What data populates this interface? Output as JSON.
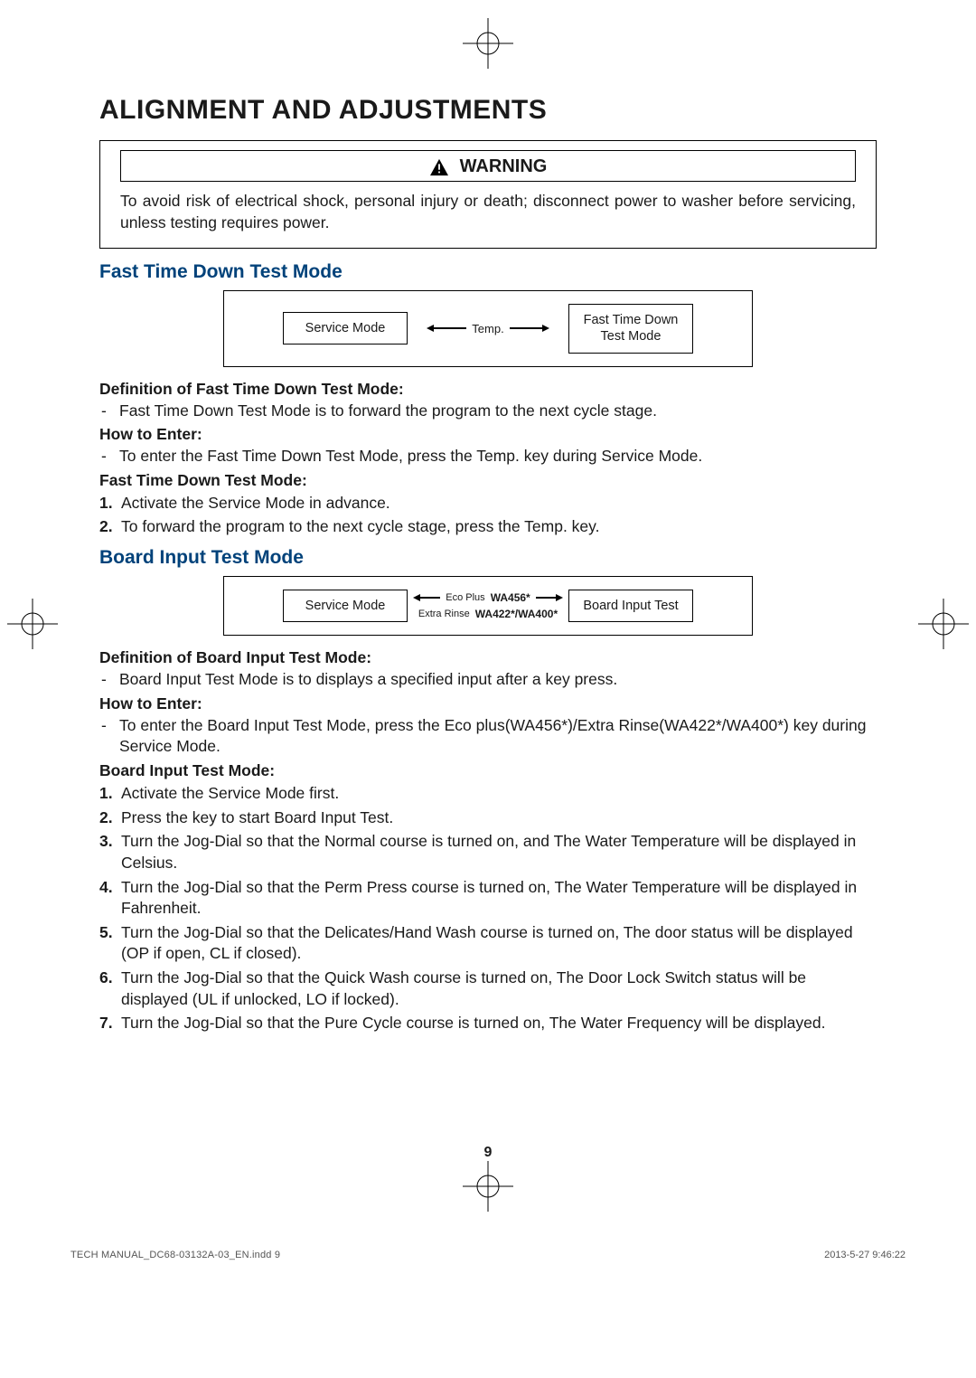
{
  "page": {
    "title": "ALIGNMENT AND ADJUSTMENTS",
    "number": "9"
  },
  "warning": {
    "label": "WARNING",
    "text": "To avoid risk of electrical shock, personal injury or death; disconnect power to washer before servicing, unless testing requires power."
  },
  "section1": {
    "heading": "Fast Time Down Test Mode",
    "diagram": {
      "left": "Service Mode",
      "middle": "Temp.",
      "right": "Fast Time Down\nTest Mode"
    },
    "def_h": "Definition of Fast Time Down Test Mode:",
    "def_t": "Fast Time Down Test Mode is to forward the program to the next cycle stage.",
    "enter_h": "How to Enter:",
    "enter_t": "To enter the Fast Time Down Test Mode, press the Temp. key during Service Mode.",
    "steps_h": "Fast Time Down Test Mode:",
    "steps": [
      "Activate the Service Mode in advance.",
      "To forward the program to the next cycle stage, press the Temp. key."
    ]
  },
  "section2": {
    "heading": "Board Input Test Mode",
    "diagram": {
      "left": "Service Mode",
      "mid_top_model": "WA456*",
      "mid_top_key": "Eco Plus",
      "mid_bot_model": "WA422*/WA400*",
      "mid_bot_key": "Extra Rinse",
      "right": "Board Input Test"
    },
    "def_h": "Definition of Board Input Test Mode:",
    "def_t": "Board Input Test Mode is to displays a specified input after a key press.",
    "enter_h": "How to Enter:",
    "enter_t": "To enter the Board Input Test Mode, press the Eco plus(WA456*)/Extra Rinse(WA422*/WA400*) key during Service Mode.",
    "steps_h": "Board Input Test Mode:",
    "steps": [
      "Activate the Service Mode first.",
      "Press the key to start Board Input Test.",
      "Turn the Jog-Dial so that the Normal course is turned on, and The Water Temperature will be displayed in Celsius.",
      "Turn the Jog-Dial so that the Perm Press course is turned on, The Water Temperature will be displayed in Fahrenheit.",
      "Turn the Jog-Dial so that the Delicates/Hand Wash course is turned on, The door status will be displayed (OP if open, CL if closed).",
      "Turn the Jog-Dial so that the Quick Wash course is turned on, The Door Lock Switch status will be displayed (UL if unlocked, LO if locked).",
      "Turn the Jog-Dial so that the Pure Cycle course is turned on, The Water Frequency will be displayed."
    ]
  },
  "footer": {
    "left": "TECH MANUAL_DC68-03132A-03_EN.indd   9",
    "right": "2013-5-27   9:46:22"
  }
}
